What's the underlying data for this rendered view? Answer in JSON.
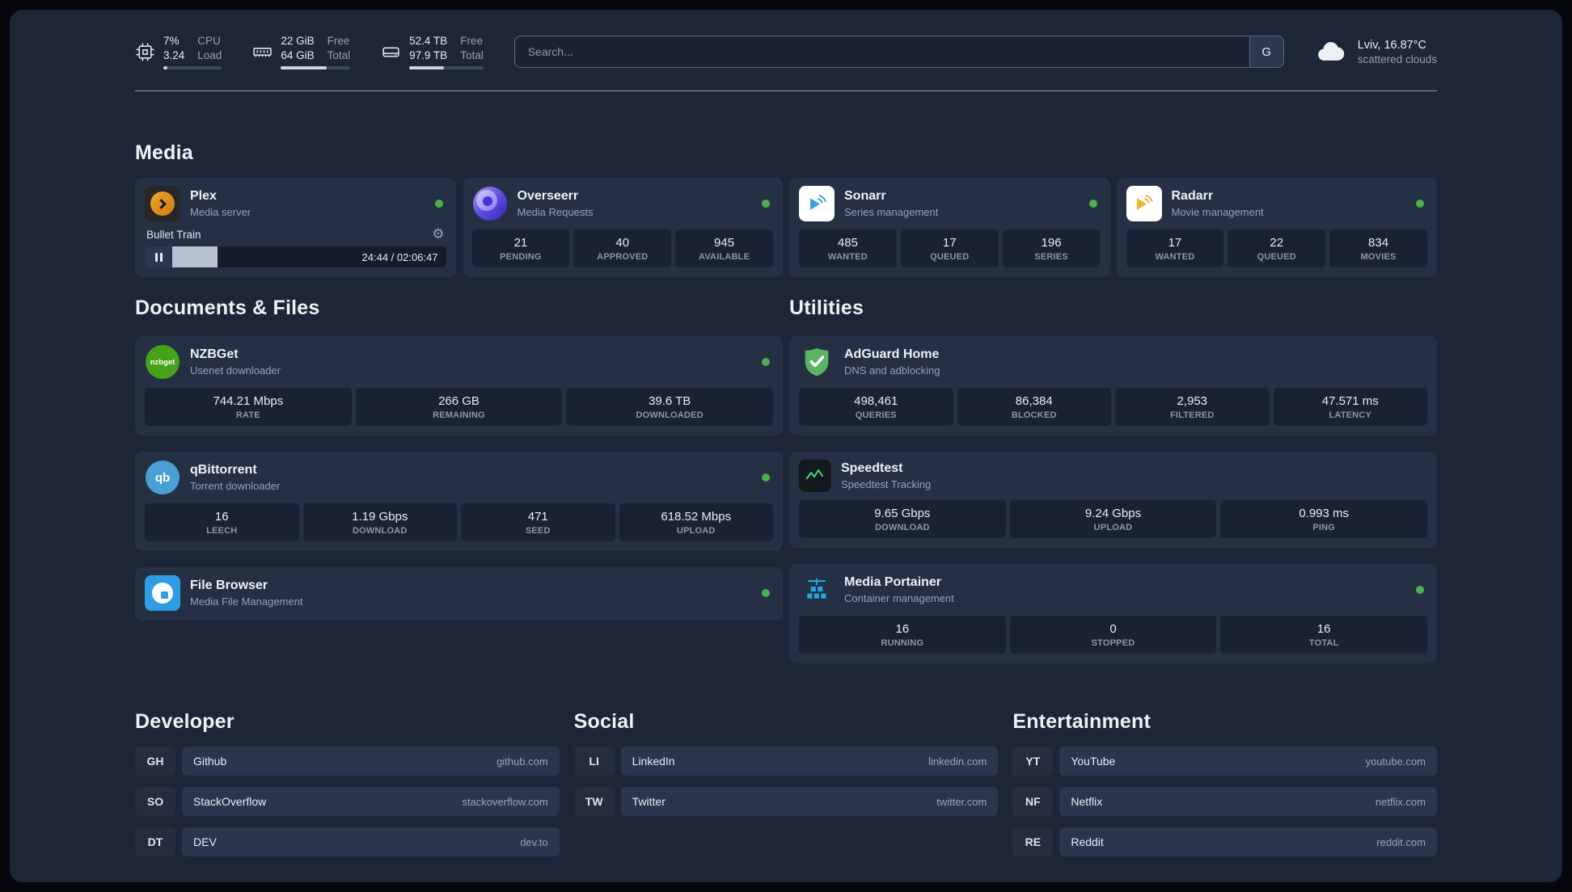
{
  "topbar": {
    "cpu": {
      "value_top": "7%",
      "value_bottom": "3.24",
      "label_top": "CPU",
      "label_bottom": "Load"
    },
    "memory": {
      "value_top": "22 GiB",
      "value_bottom": "64 GiB",
      "label_top": "Free",
      "label_bottom": "Total"
    },
    "disk": {
      "value_top": "52.4 TB",
      "value_bottom": "97.9 TB",
      "label_top": "Free",
      "label_bottom": "Total"
    },
    "search": {
      "placeholder": "Search...",
      "button_label": "G"
    },
    "weather": {
      "location": "Lviv, 16.87°C",
      "condition": "scattered clouds"
    }
  },
  "media": {
    "heading": "Media",
    "plex": {
      "name": "Plex",
      "desc": "Media server",
      "now_playing": "Bullet Train",
      "time": "24:44 / 02:06:47"
    },
    "overseerr": {
      "name": "Overseerr",
      "desc": "Media Requests",
      "stats": [
        {
          "value": "21",
          "label": "PENDING"
        },
        {
          "value": "40",
          "label": "APPROVED"
        },
        {
          "value": "945",
          "label": "AVAILABLE"
        }
      ]
    },
    "sonarr": {
      "name": "Sonarr",
      "desc": "Series management",
      "stats": [
        {
          "value": "485",
          "label": "WANTED"
        },
        {
          "value": "17",
          "label": "QUEUED"
        },
        {
          "value": "196",
          "label": "SERIES"
        }
      ]
    },
    "radarr": {
      "name": "Radarr",
      "desc": "Movie management",
      "stats": [
        {
          "value": "17",
          "label": "WANTED"
        },
        {
          "value": "22",
          "label": "QUEUED"
        },
        {
          "value": "834",
          "label": "MOVIES"
        }
      ]
    }
  },
  "documents": {
    "heading": "Documents & Files",
    "nzbget": {
      "name": "NZBGet",
      "desc": "Usenet downloader",
      "icon_text": "nzbget",
      "stats": [
        {
          "value": "744.21 Mbps",
          "label": "RATE"
        },
        {
          "value": "266 GB",
          "label": "REMAINING"
        },
        {
          "value": "39.6 TB",
          "label": "DOWNLOADED"
        }
      ]
    },
    "qbittorrent": {
      "name": "qBittorrent",
      "desc": "Torrent downloader",
      "icon_text": "qb",
      "stats": [
        {
          "value": "16",
          "label": "LEECH"
        },
        {
          "value": "1.19 Gbps",
          "label": "DOWNLOAD"
        },
        {
          "value": "471",
          "label": "SEED"
        },
        {
          "value": "618.52 Mbps",
          "label": "UPLOAD"
        }
      ]
    },
    "filebrowser": {
      "name": "File Browser",
      "desc": "Media File Management"
    }
  },
  "utilities": {
    "heading": "Utilities",
    "adguard": {
      "name": "AdGuard Home",
      "desc": "DNS and adblocking",
      "stats": [
        {
          "value": "498,461",
          "label": "QUERIES"
        },
        {
          "value": "86,384",
          "label": "BLOCKED"
        },
        {
          "value": "2,953",
          "label": "FILTERED"
        },
        {
          "value": "47.571 ms",
          "label": "LATENCY"
        }
      ]
    },
    "speedtest": {
      "name": "Speedtest",
      "desc": "Speedtest Tracking",
      "stats": [
        {
          "value": "9.65 Gbps",
          "label": "DOWNLOAD"
        },
        {
          "value": "9.24 Gbps",
          "label": "UPLOAD"
        },
        {
          "value": "0.993 ms",
          "label": "PING"
        }
      ]
    },
    "portainer": {
      "name": "Media Portainer",
      "desc": "Container management",
      "stats": [
        {
          "value": "16",
          "label": "RUNNING"
        },
        {
          "value": "0",
          "label": "STOPPED"
        },
        {
          "value": "16",
          "label": "TOTAL"
        }
      ]
    }
  },
  "bookmarks": {
    "developer": {
      "heading": "Developer",
      "items": [
        {
          "abbr": "GH",
          "name": "Github",
          "url": "github.com"
        },
        {
          "abbr": "SO",
          "name": "StackOverflow",
          "url": "stackoverflow.com"
        },
        {
          "abbr": "DT",
          "name": "DEV",
          "url": "dev.to"
        }
      ]
    },
    "social": {
      "heading": "Social",
      "items": [
        {
          "abbr": "LI",
          "name": "LinkedIn",
          "url": "linkedin.com"
        },
        {
          "abbr": "TW",
          "name": "Twitter",
          "url": "twitter.com"
        }
      ]
    },
    "entertainment": {
      "heading": "Entertainment",
      "items": [
        {
          "abbr": "YT",
          "name": "YouTube",
          "url": "youtube.com"
        },
        {
          "abbr": "NF",
          "name": "Netflix",
          "url": "netflix.com"
        },
        {
          "abbr": "RE",
          "name": "Reddit",
          "url": "reddit.com"
        }
      ]
    }
  }
}
